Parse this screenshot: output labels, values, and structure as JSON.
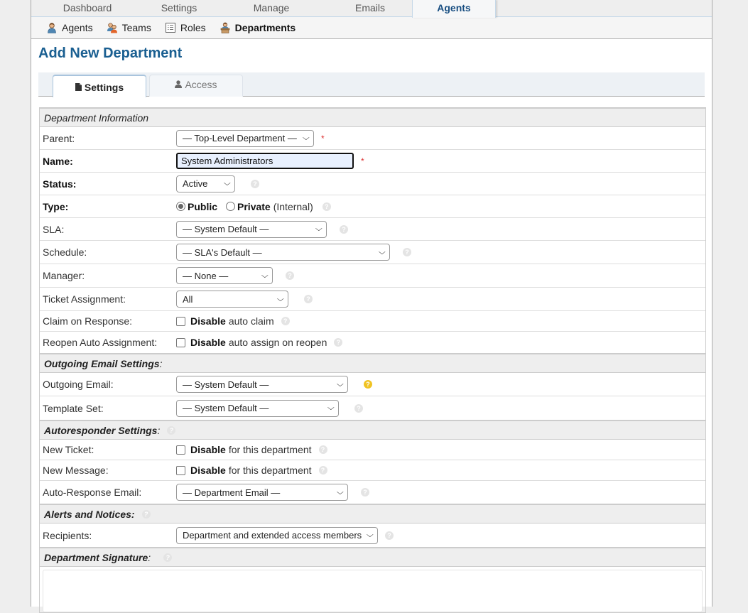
{
  "nav": {
    "tabs": [
      {
        "label": "Dashboard"
      },
      {
        "label": "Settings"
      },
      {
        "label": "Manage"
      },
      {
        "label": "Emails"
      },
      {
        "label": "Agents",
        "active": true
      }
    ]
  },
  "subnav": {
    "items": [
      {
        "label": "Agents",
        "icon": "agent-icon"
      },
      {
        "label": "Teams",
        "icon": "teams-icon"
      },
      {
        "label": "Roles",
        "icon": "roles-icon"
      },
      {
        "label": "Departments",
        "icon": "department-icon",
        "active": true
      }
    ]
  },
  "page": {
    "title": "Add New Department"
  },
  "form_tabs": [
    {
      "label": "Settings",
      "icon": "file-icon",
      "active": true
    },
    {
      "label": "Access",
      "icon": "user-icon"
    }
  ],
  "sections": {
    "dept_info": "Department Information",
    "outgoing": "Outgoing Email Settings",
    "autoresponder": "Autoresponder Settings",
    "alerts": "Alerts and Notices:",
    "signature": "Department Signature"
  },
  "fields": {
    "parent": {
      "label": "Parent:",
      "value": "— Top-Level Department —",
      "required": "*"
    },
    "name": {
      "label": "Name:",
      "value": "System Administrators",
      "required": "*"
    },
    "status": {
      "label": "Status:",
      "value": "Active"
    },
    "type": {
      "label": "Type:",
      "public": "Public",
      "private": "Private",
      "private_note": "(Internal)",
      "selected": "Public"
    },
    "sla": {
      "label": "SLA:",
      "value": "— System Default —"
    },
    "schedule": {
      "label": "Schedule:",
      "value": "— SLA's Default —"
    },
    "manager": {
      "label": "Manager:",
      "value": "— None —"
    },
    "ticket_assignment": {
      "label": "Ticket Assignment:",
      "value": "All"
    },
    "claim_on_response": {
      "label": "Claim on Response:",
      "bold": "Disable",
      "text": "auto claim",
      "checked": false
    },
    "reopen_auto_assignment": {
      "label": "Reopen Auto Assignment:",
      "bold": "Disable",
      "text": "auto assign on reopen",
      "checked": false
    },
    "outgoing_email": {
      "label": "Outgoing Email:",
      "value": "— System Default —"
    },
    "template_set": {
      "label": "Template Set:",
      "value": "— System Default —"
    },
    "new_ticket": {
      "label": "New Ticket:",
      "bold": "Disable",
      "text": "for this department",
      "checked": false
    },
    "new_message": {
      "label": "New Message:",
      "bold": "Disable",
      "text": "for this department",
      "checked": false
    },
    "auto_response_email": {
      "label": "Auto-Response Email:",
      "value": "— Department Email —"
    },
    "recipients": {
      "label": "Recipients:",
      "value": "Department and extended access members"
    },
    "signature": {
      "value": ""
    }
  },
  "colors": {
    "title": "#1a5f91",
    "active_nav": "#184e81",
    "required": "#dd3333",
    "help_highlight": "#f0c323"
  }
}
